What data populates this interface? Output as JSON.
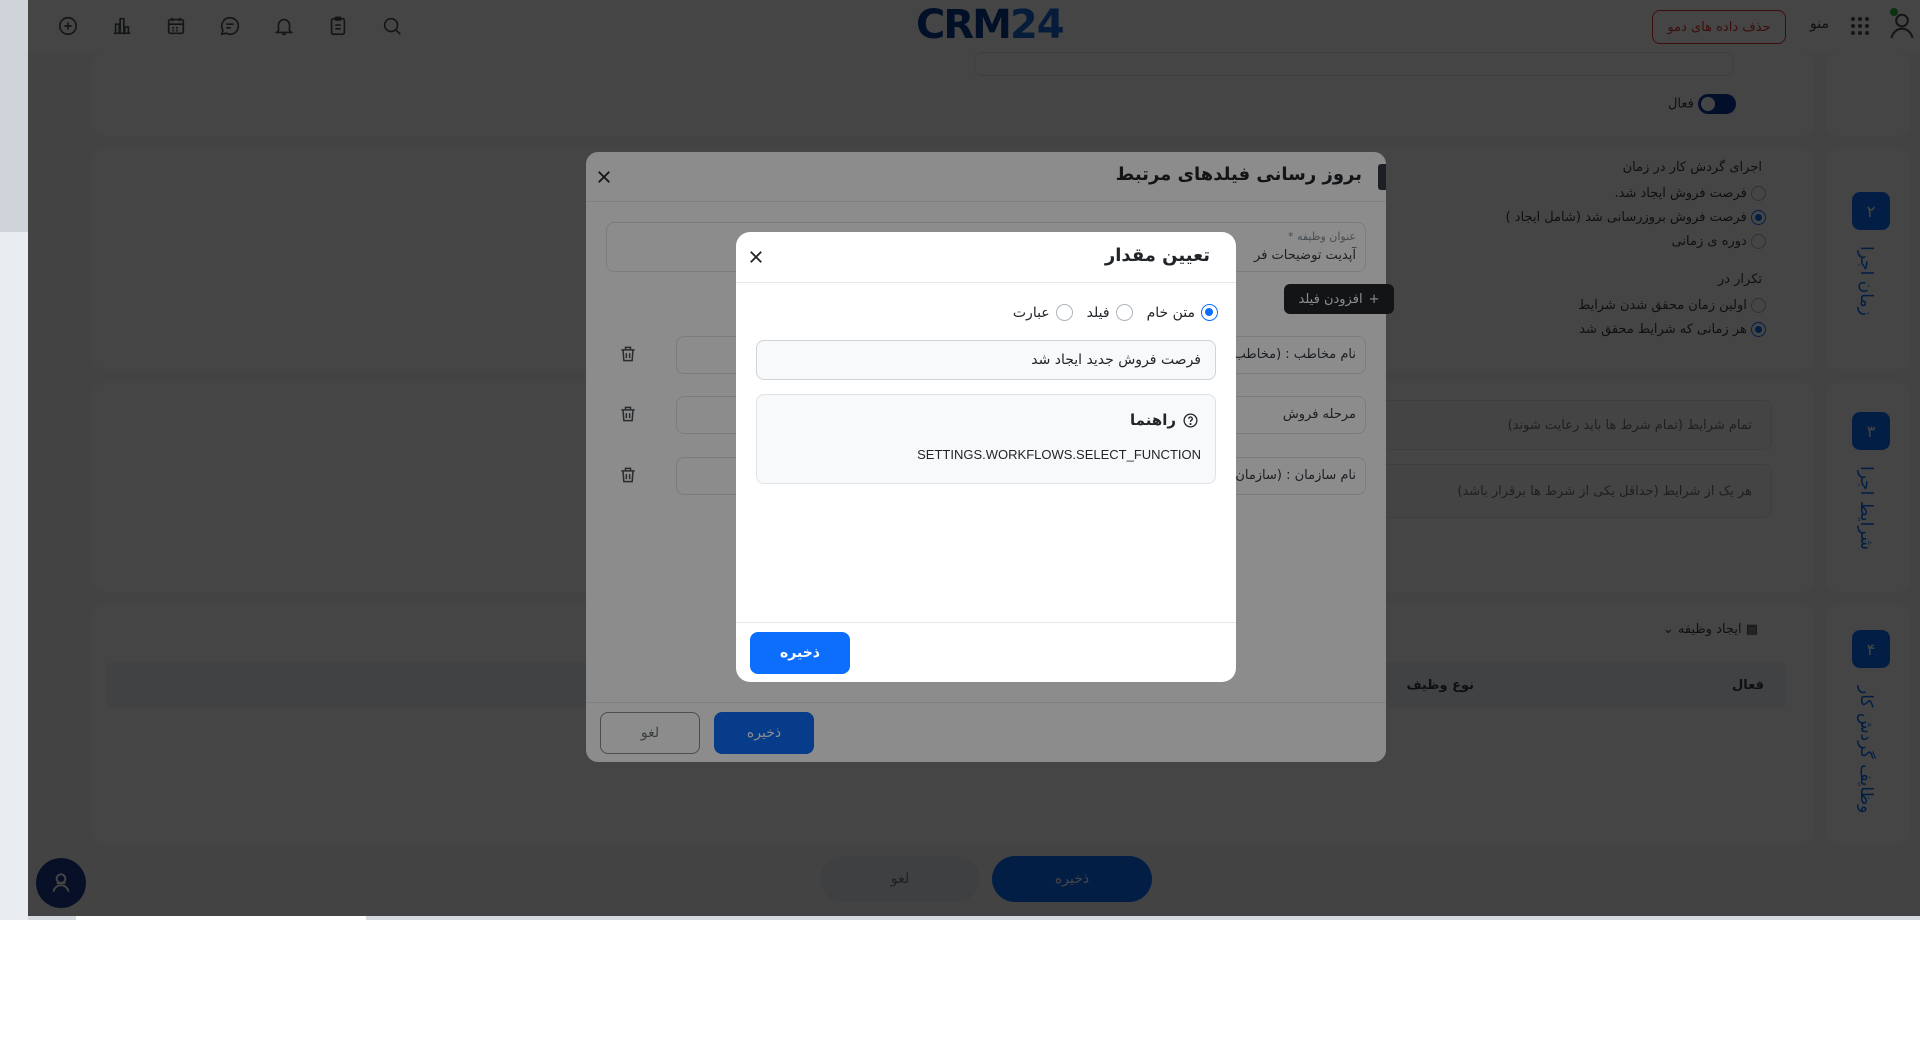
{
  "header": {
    "logo_crm": "CRM",
    "logo_num": "24",
    "demo_button": "حذف داده های دمو",
    "menu_label": "منو"
  },
  "background": {
    "active_label": "فعال",
    "run_time_heading": "اجرای گردش کار در زمان",
    "run_options": [
      {
        "label": "فرصت فروش ایجاد شد.",
        "selected": false
      },
      {
        "label": "فرصت فروش بروزرسانی شد (شامل ایجاد )",
        "selected": true
      },
      {
        "label": "دوره ی زمانی",
        "selected": false
      }
    ],
    "repeat_heading": "تکرار در",
    "repeat_options": [
      {
        "label": "اولین زمان محقق شدن شرایط",
        "selected": false
      },
      {
        "label": "هر زمانی که شرایط محقق شد",
        "selected": true
      }
    ],
    "conditions_all": "تمام شرایط (تمام شرط ها باید رعایت شوند)",
    "conditions_any": "هر یک از شرایط (حداقل یکی از شرط ها برقرار باشد)",
    "create_task": "ایجاد وظیفه",
    "table_col_active": "فعال",
    "table_col_task_type": "نوع وظیف",
    "steps": [
      {
        "num": "۲",
        "title": "زمان اجرا"
      },
      {
        "num": "۳",
        "title": "شرایط اجرا"
      },
      {
        "num": "۴",
        "title": "وظایف گردش کار"
      }
    ],
    "save_button": "ذخیره",
    "cancel_button": "لغو"
  },
  "modal_update": {
    "title": "بروز رسانی فیلدهای مرتبط",
    "task_title_label": "عنوان وظیفه *",
    "task_title_value": "آپدیت توضیحات فر",
    "add_field_button": "افزودن فیلد",
    "fields": [
      {
        "label": "نام مخاطب : (مخاطب"
      },
      {
        "label": "مرحله فروش"
      },
      {
        "label": "نام سازمان : (سازمان"
      }
    ],
    "save_button": "ذخیره",
    "cancel_button": "لغو"
  },
  "modal_set_value": {
    "title": "تعیین مقدار",
    "type_options": [
      {
        "label": "متن خام",
        "selected": true
      },
      {
        "label": "فیلد",
        "selected": false
      },
      {
        "label": "عبارت",
        "selected": false
      }
    ],
    "value": "فرصت فروش جدید ایجاد شد",
    "guide_title": "راهنما",
    "guide_body": "SETTINGS.WORKFLOWS.SELECT_FUNCTION",
    "save_button": "ذخیره"
  }
}
